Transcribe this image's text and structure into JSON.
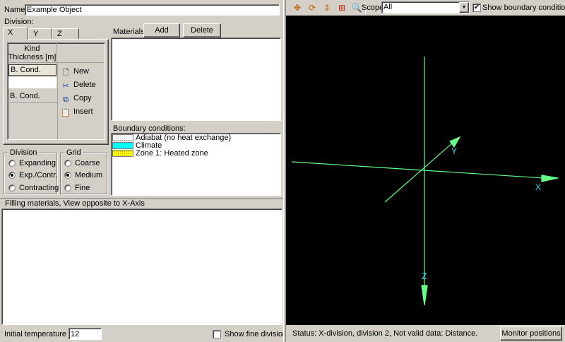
{
  "name_field": {
    "label": "Name",
    "value": "Example Object"
  },
  "division": {
    "label": "Division:",
    "tabs": [
      "X",
      "Y",
      "Z"
    ],
    "table_header": "Kind\nThickness [m]",
    "rows": [
      "B. Cond.",
      "",
      "B. Cond."
    ],
    "context_menu": [
      {
        "label": "New",
        "icon": "new-page-icon"
      },
      {
        "label": "Delete",
        "icon": "scissors-icon"
      },
      {
        "label": "Copy",
        "icon": "copy-icon"
      },
      {
        "label": "Insert",
        "icon": "paste-icon"
      }
    ]
  },
  "materials": {
    "label": "Materials:",
    "add": "Add",
    "delete": "Delete"
  },
  "boundary": {
    "label": "Boundary conditions:",
    "items": [
      {
        "label": "Adiabat (no heat exchange)",
        "color": "#ffffff"
      },
      {
        "label": "Climate",
        "color": "#00ffff"
      },
      {
        "label": "Zone 1: Heated zone",
        "color": "#ffff00"
      }
    ]
  },
  "division_group": {
    "title": "Division",
    "options": [
      "Expanding",
      "Exp./Contr.",
      "Contracting"
    ],
    "selected": 1
  },
  "grid_group": {
    "title": "Grid",
    "options": [
      "Coarse",
      "Medium",
      "Fine"
    ],
    "selected": 1
  },
  "filling": {
    "label": "Filling materials, View opposite to X-Axis"
  },
  "bottom": {
    "temp_label": "Initial temperature [°C]",
    "temp_value": "12",
    "fine_label": "Show fine division",
    "fine_checked": false
  },
  "toolbar": {
    "icons": [
      "pan-icon",
      "rotate-icon",
      "move-icon",
      "fit-icon",
      "zoom-icon"
    ],
    "scope_label": "Scope",
    "scope_value": "All",
    "show_bc_label": "Show boundary conditions",
    "show_bc_checked": true
  },
  "viewport": {
    "axes": [
      "X",
      "Y",
      "Z"
    ],
    "axis_color": "#66ff88",
    "label_color": "#33ddff"
  },
  "status": {
    "text": "Status: X-division, division 2, Not valid data: Distance.",
    "monitor_button": "Monitor positions"
  }
}
